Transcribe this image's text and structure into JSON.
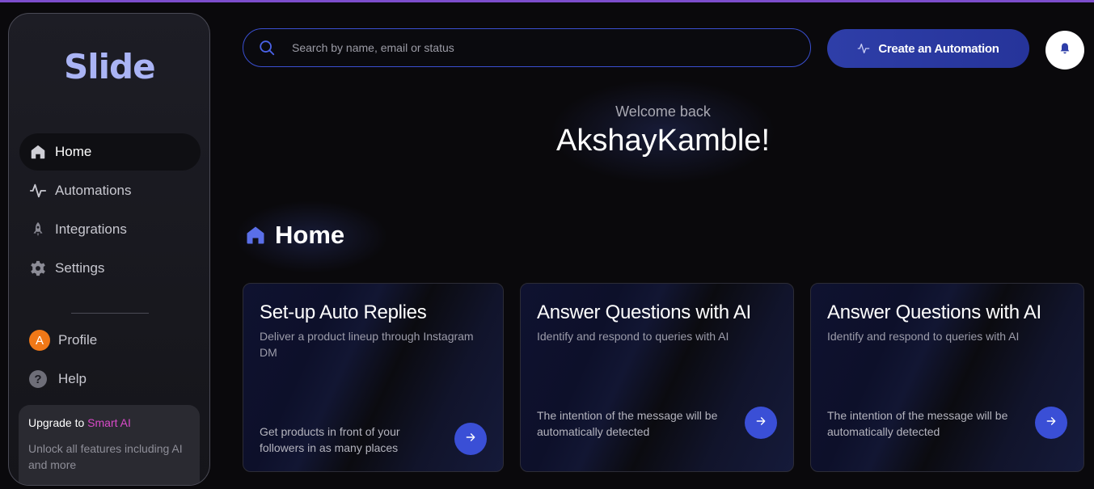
{
  "brand": {
    "logo_text": "Slide"
  },
  "sidebar": {
    "items": [
      {
        "label": "Home",
        "icon": "home-icon",
        "active": true
      },
      {
        "label": "Automations",
        "icon": "activity-icon"
      },
      {
        "label": "Integrations",
        "icon": "rocket-icon"
      },
      {
        "label": "Settings",
        "icon": "gear-icon"
      }
    ],
    "profile": {
      "label": "Profile",
      "avatar_initial": "A",
      "avatar_color": "#f07817"
    },
    "help": {
      "label": "Help",
      "icon_glyph": "?"
    },
    "upgrade": {
      "prefix": "Upgrade to ",
      "highlight": "Smart AI",
      "description": "Unlock all features including AI and more"
    }
  },
  "search": {
    "placeholder": "Search by name, email or status",
    "value": ""
  },
  "header": {
    "create_label": "Create an Automation"
  },
  "welcome": {
    "greeting": "Welcome back",
    "name": "AkshayKamble!"
  },
  "section": {
    "title": "Home"
  },
  "cards": [
    {
      "title": "Set-up Auto Replies",
      "description": "Deliver a product lineup through Instagram DM",
      "footer": "Get products in front of your followers in as many places"
    },
    {
      "title": "Answer Questions with AI",
      "description": "Identify and respond to queries with AI",
      "footer": "The intention of the message will be automatically detected"
    },
    {
      "title": "Answer Questions with AI",
      "description": "Identify and respond to queries with AI",
      "footer": "The intention of the message will be automatically detected"
    }
  ],
  "colors": {
    "accent": "#3a4fd6",
    "brand": "#aab4f5",
    "smart_ai": "#d94ac9"
  }
}
